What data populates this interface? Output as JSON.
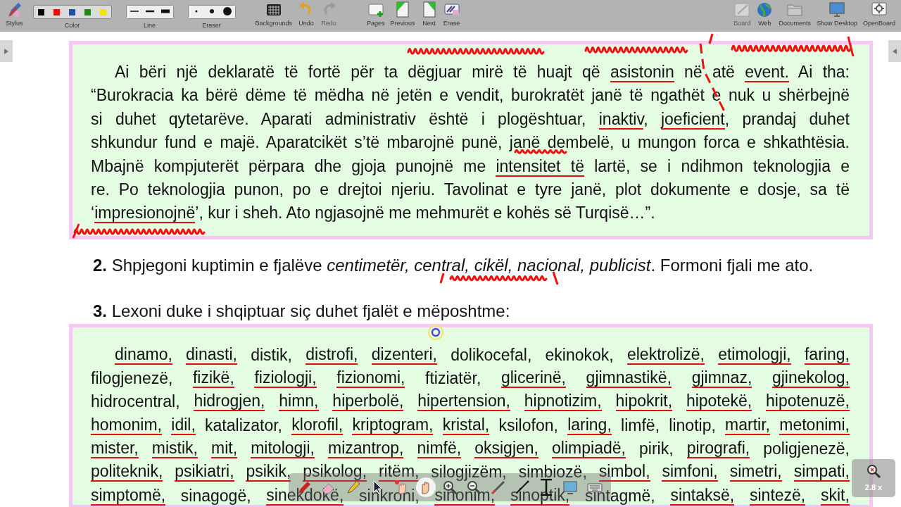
{
  "toolbar": {
    "left": [
      {
        "kind": "tool",
        "label": "Stylus",
        "disabled": false
      },
      {
        "kind": "colors",
        "label": "Color",
        "swatches": [
          {
            "color": "#000000"
          },
          {
            "color": "#ff0000"
          },
          {
            "color": "#1f4fa0"
          },
          {
            "color": "#1a8a1a"
          },
          {
            "color": "#f2e600"
          }
        ]
      },
      {
        "kind": "widths",
        "label": "Line"
      },
      {
        "kind": "sizes",
        "label": "Eraser"
      },
      {
        "kind": "tool",
        "label": "Backgrounds",
        "disabled": false
      },
      {
        "kind": "tool",
        "label": "Undo",
        "disabled": false
      },
      {
        "kind": "tool",
        "label": "Redo",
        "disabled": true
      },
      {
        "kind": "tool",
        "label": "Pages",
        "disabled": false
      },
      {
        "kind": "tool",
        "label": "Previous",
        "disabled": false
      },
      {
        "kind": "tool",
        "label": "Next",
        "disabled": false
      },
      {
        "kind": "tool",
        "label": "Erase",
        "disabled": false
      }
    ],
    "right": [
      {
        "label": "Board",
        "disabled": true
      },
      {
        "label": "Web",
        "disabled": false
      },
      {
        "label": "Documents",
        "disabled": false
      },
      {
        "label": "Show Desktop",
        "disabled": false
      },
      {
        "label": "OpenBoard",
        "disabled": false
      }
    ]
  },
  "passage": [
    [
      {
        "text": "Ai bëri një deklaratë të fortë për ta dëgjuar mirë të huajt që ",
        "underlined": false
      },
      {
        "text": "asistonin",
        "underlined": true
      },
      {
        "text": " në atë ",
        "underlined": false
      },
      {
        "text": "event.",
        "underlined": true
      },
      {
        "text": " Ai tha:",
        "underlined": false
      }
    ],
    [
      {
        "text": "“Burokracia ka bërë dëme të mëdha në jetën e vendit, burokratët janë të ngathët e nuk u shërbejnë",
        "underlined": false
      }
    ],
    [
      {
        "text": "si duhet qytetarëve. Aparati administrativ është i plogështuar, ",
        "underlined": false
      },
      {
        "text": "inaktiv",
        "underlined": true
      },
      {
        "text": ", ",
        "underlined": false
      },
      {
        "text": "joeficient",
        "underlined": true
      },
      {
        "text": ", prandaj duhet",
        "underlined": false
      }
    ],
    [
      {
        "text": "shkundur fund e majë. Aparatcikët s’të mbarojnë punë, janë dembelë, u mungon forca e shkathtësia.",
        "underlined": false
      }
    ],
    [
      {
        "text": "Mbajnë kompjuterët përpara dhe gjoja punojnë me ",
        "underlined": false
      },
      {
        "text": "intensitet të",
        "underlined": true
      },
      {
        "text": " lartë, se i ndihmon teknologjia e",
        "underlined": false
      }
    ],
    [
      {
        "text": "re. Po teknologjia punon, po e drejtoi njeriu. Tavolinat e tyre janë, plot dokumente e dosje, sa të",
        "underlined": false
      }
    ],
    [
      {
        "text": "‘",
        "underlined": false
      },
      {
        "text": "impresionojnë",
        "underlined": true
      },
      {
        "text": "’, kur i sheh. Ato ngjasojnë me mehmurët e kohës së Turqisë…”.",
        "underlined": false
      }
    ]
  ],
  "question_2": "**2.** Shpjegoni kuptimin e fjalëve *centimetër, central, cikël, nacional, publicist*. Formoni fjali me ato.",
  "question_3": "**3.** Lexoni duke i shqiptuar siç duhet fjalët e mëposhtme:",
  "word_lines": [
    [
      {
        "text": "dinamo,",
        "underlined": true
      },
      {
        "text": "dinasti,",
        "underlined": true
      },
      {
        "text": "distik,",
        "underlined": false
      },
      {
        "text": "distrofi,",
        "underlined": true
      },
      {
        "text": "dizenteri,",
        "underlined": true
      },
      {
        "text": "dolikocefal,",
        "underlined": false
      },
      {
        "text": "ekinokok,",
        "underlined": false
      },
      {
        "text": "elektrolizë,",
        "underlined": true
      },
      {
        "text": "etimologji,",
        "underlined": true
      },
      {
        "text": "faring,",
        "underlined": true
      }
    ],
    [
      {
        "text": "filogjenezë,",
        "underlined": false
      },
      {
        "text": "fizikë,",
        "underlined": true
      },
      {
        "text": "fiziologji,",
        "underlined": true
      },
      {
        "text": "fizionomi,",
        "underlined": true
      },
      {
        "text": "ftiziatër,",
        "underlined": false
      },
      {
        "text": "glicerinë,",
        "underlined": true
      },
      {
        "text": "gjimnastikë,",
        "underlined": true
      },
      {
        "text": "gjimnaz,",
        "underlined": true
      },
      {
        "text": "gjinekolog,",
        "underlined": true
      }
    ],
    [
      {
        "text": "hidrocentral,",
        "underlined": false
      },
      {
        "text": "hidrogjen,",
        "underlined": true
      },
      {
        "text": "himn,",
        "underlined": true
      },
      {
        "text": "hiperbolë,",
        "underlined": true
      },
      {
        "text": "hipertension,",
        "underlined": true
      },
      {
        "text": "hipnotizim,",
        "underlined": true
      },
      {
        "text": "hipokrit,",
        "underlined": true
      },
      {
        "text": "hipotekë,",
        "underlined": true
      },
      {
        "text": "hipotenuzë,",
        "underlined": true
      }
    ],
    [
      {
        "text": "homonim,",
        "underlined": true
      },
      {
        "text": "idil,",
        "underlined": true
      },
      {
        "text": "katalizator,",
        "underlined": false
      },
      {
        "text": "klorofil,",
        "underlined": true
      },
      {
        "text": "kriptogram,",
        "underlined": true
      },
      {
        "text": "kristal,",
        "underlined": true
      },
      {
        "text": "ksilofon,",
        "underlined": false
      },
      {
        "text": "laring,",
        "underlined": true
      },
      {
        "text": "limfë,",
        "underlined": false
      },
      {
        "text": "linotip,",
        "underlined": false
      },
      {
        "text": "martir,",
        "underlined": true
      },
      {
        "text": "metonimi,",
        "underlined": true
      }
    ],
    [
      {
        "text": "mister,",
        "underlined": true
      },
      {
        "text": "mistik,",
        "underlined": true
      },
      {
        "text": "mit,",
        "underlined": true
      },
      {
        "text": "mitologji,",
        "underlined": true
      },
      {
        "text": "mizantrop,",
        "underlined": true
      },
      {
        "text": "nimfë,",
        "underlined": true
      },
      {
        "text": "oksigjen,",
        "underlined": true
      },
      {
        "text": "olimpiadë,",
        "underlined": true
      },
      {
        "text": "pirik,",
        "underlined": false
      },
      {
        "text": "pirografi,",
        "underlined": true
      },
      {
        "text": "poligjenezë,",
        "underlined": false
      }
    ],
    [
      {
        "text": "politeknik,",
        "underlined": true
      },
      {
        "text": "psikiatri,",
        "underlined": true
      },
      {
        "text": "psikik,",
        "underlined": true
      },
      {
        "text": "psikolog,",
        "underlined": true
      },
      {
        "text": "ritëm,",
        "underlined": true
      },
      {
        "text": "silogjizëm,",
        "underlined": false
      },
      {
        "text": "simbiozë,",
        "underlined": false
      },
      {
        "text": "simbol,",
        "underlined": true
      },
      {
        "text": "simfoni,",
        "underlined": true
      },
      {
        "text": "simetri,",
        "underlined": true
      },
      {
        "text": "simpati,",
        "underlined": true
      }
    ],
    [
      {
        "text": "simptomë,",
        "underlined": true
      },
      {
        "text": "sinagogë,",
        "underlined": false
      },
      {
        "text": "sinekdokë,",
        "underlined": true
      },
      {
        "text": "sinkroni,",
        "underlined": false
      },
      {
        "text": "sinonim,",
        "underlined": true
      },
      {
        "text": "sinoptik,",
        "underlined": true
      },
      {
        "text": "sintagmë,",
        "underlined": false
      },
      {
        "text": "sintaksë,",
        "underlined": true
      },
      {
        "text": "sintezë,",
        "underlined": true
      },
      {
        "text": "skit,",
        "underlined": true
      }
    ]
  ],
  "floating_tools": [
    {
      "selected": false
    },
    {
      "selected": false
    },
    {
      "selected": false
    },
    {
      "selected": false
    },
    {
      "selected": false
    },
    {
      "selected": true
    },
    {
      "selected": false
    },
    {
      "selected": false
    },
    {
      "selected": false
    },
    {
      "selected": false
    },
    {
      "selected": false
    },
    {
      "selected": false
    },
    {
      "selected": false
    }
  ],
  "zoom_widget": {
    "label": "2.8 x"
  }
}
